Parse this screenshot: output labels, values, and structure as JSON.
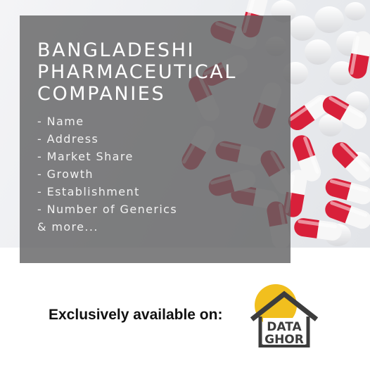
{
  "banner": {
    "title_lines": [
      "BANGLADESHI",
      "PHARMACEUTICAL",
      "COMPANIES"
    ],
    "features": [
      "- Name",
      "- Address",
      "- Market Share",
      "- Growth",
      "- Establishment",
      "- Number of Generics",
      "& more..."
    ]
  },
  "footer": {
    "availability_text": "Exclusively available on:"
  },
  "logo": {
    "line1": "DATA",
    "line2": "GHOR",
    "sun_color": "#f1bf1e",
    "house_color": "#3c3c3c"
  },
  "colors": {
    "capsule_red": "#d8203a",
    "panel_gray": "#606062"
  },
  "icons": [
    "capsule-pill-icon",
    "tablet-pill-icon",
    "house-logo-icon"
  ]
}
